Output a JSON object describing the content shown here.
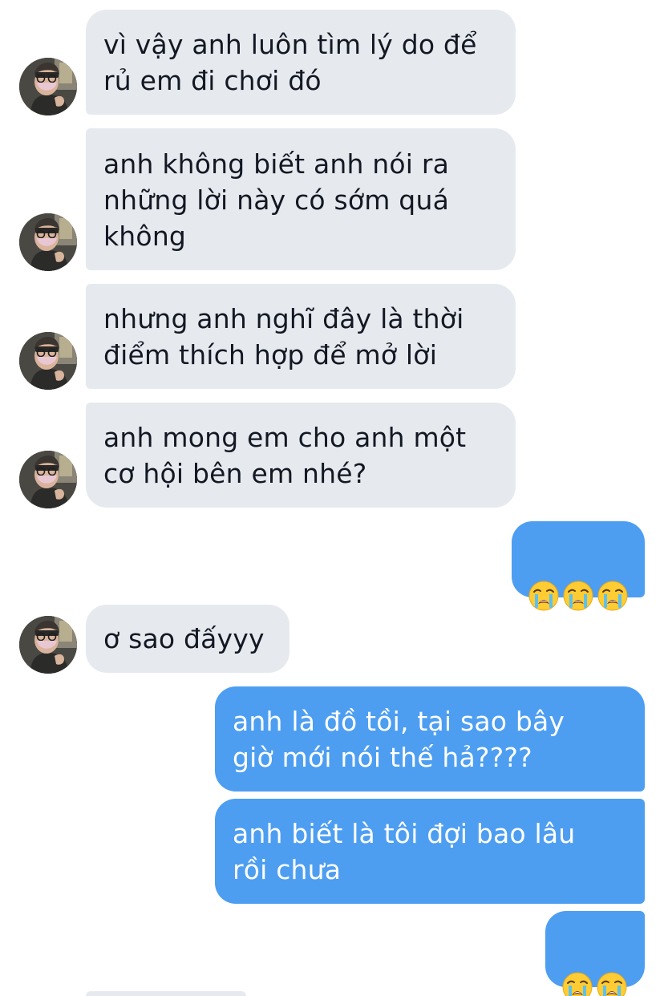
{
  "conversation": {
    "incoming": [
      {
        "text": "vì vậy anh luôn tìm lý do để\nrủ em đi chơi đó"
      },
      {
        "text": "anh không biết anh nói ra\nnhững lời này có sớm quá\nkhông"
      },
      {
        "text": "nhưng anh nghĩ đây là thời\nđiểm thích hợp để mở lời"
      },
      {
        "text": "anh mong em cho anh một\ncơ hội bên em nhé?"
      },
      {
        "text": "ơ sao đấyyy"
      }
    ],
    "outgoing": [
      {
        "emoji": [
          "crying-face",
          "crying-face",
          "crying-face"
        ]
      },
      {
        "text": "anh là đồ tồi, tại sao bây\ngiờ mới nói thế hả????"
      },
      {
        "text": "anh biết là tôi đợi bao lâu\nrồi chưa"
      },
      {
        "emoji": [
          "crying-face",
          "crying-face"
        ]
      }
    ]
  },
  "theme": {
    "incoming_bubble": "#e6eaef",
    "incoming_text": "#141823",
    "outgoing_bubble": "#4d9ef1",
    "outgoing_text": "#ffffff"
  }
}
